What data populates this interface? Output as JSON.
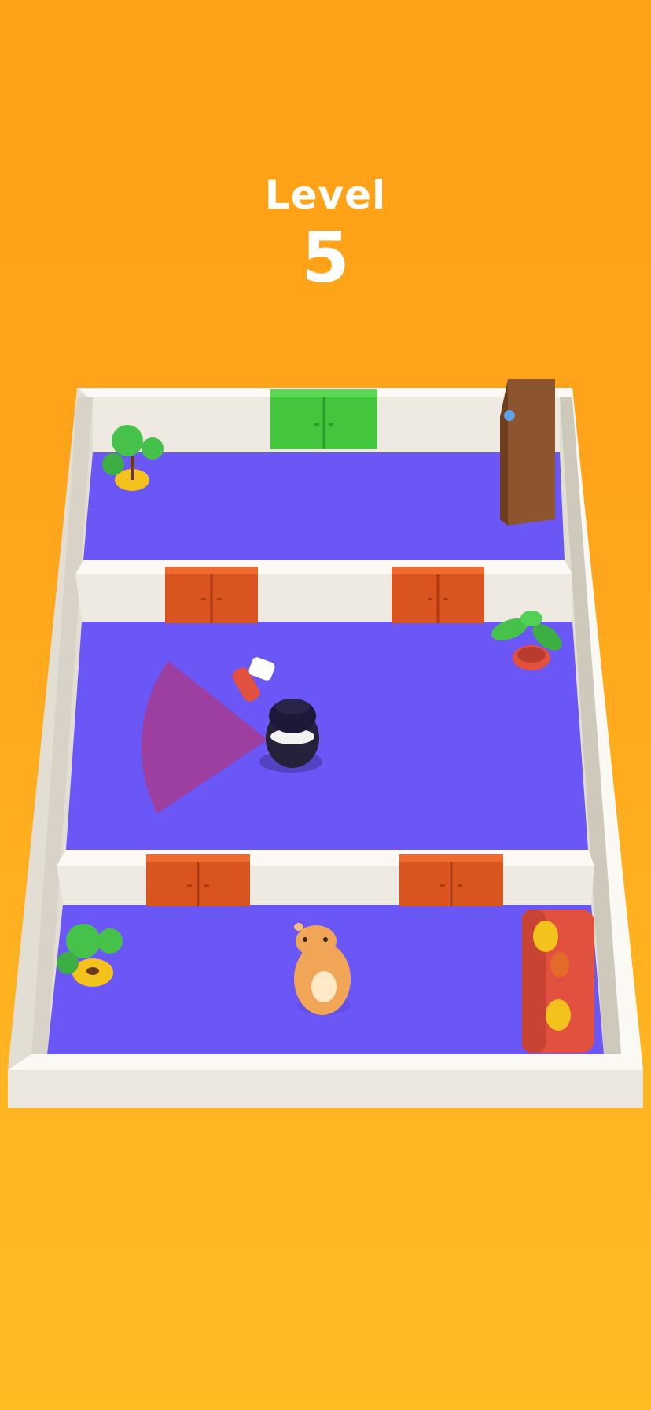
{
  "hud": {
    "level_label": "Level",
    "level_number": "5"
  },
  "scene": {
    "rooms": [
      "top-room",
      "middle-room",
      "bottom-room"
    ],
    "doors": [
      {
        "room": "top",
        "color": "#43C53E",
        "kind": "exit-door"
      },
      {
        "room": "middle-left",
        "color": "#D9541F",
        "kind": "door"
      },
      {
        "room": "middle-right",
        "color": "#D9541F",
        "kind": "door"
      },
      {
        "room": "bottom-left",
        "color": "#D9541F",
        "kind": "door"
      },
      {
        "room": "bottom-right",
        "color": "#D9541F",
        "kind": "door"
      }
    ],
    "characters": [
      "guard-with-flashlight",
      "hamster-player"
    ],
    "props": [
      "potted-tree",
      "potted-plant",
      "bookshelf",
      "sofa"
    ]
  },
  "colors": {
    "background_top": "#FFA216",
    "background_bottom": "#FFBD22",
    "floor": "#6B57F5",
    "wall": "#F2EFE8",
    "door_orange": "#D9541F",
    "door_green": "#43C53E",
    "vision_cone": "#B0357E",
    "hamster": "#F0A656",
    "sofa": "#E2503F",
    "bookshelf": "#8D5430"
  }
}
